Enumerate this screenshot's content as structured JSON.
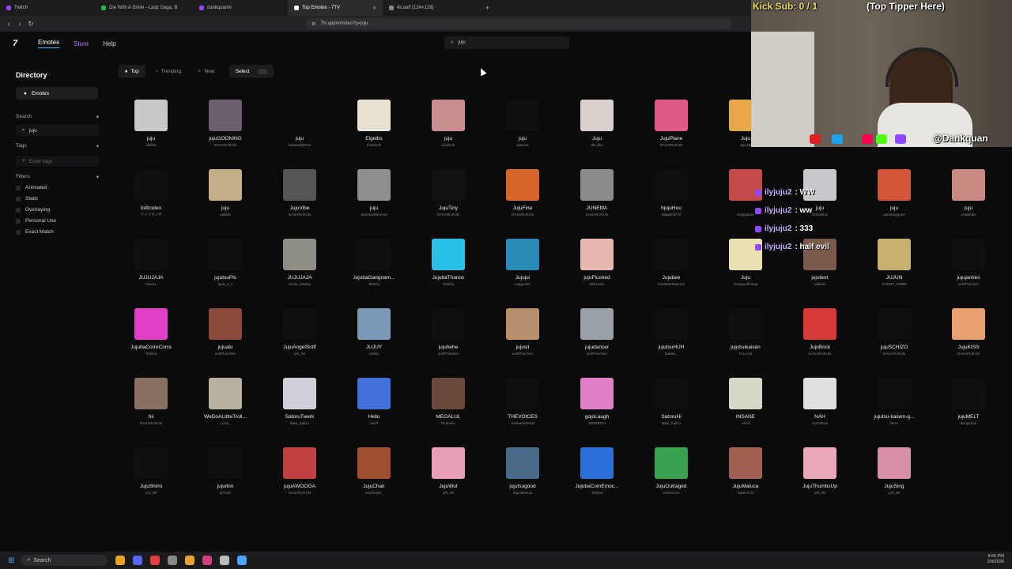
{
  "browser": {
    "tabs": [
      {
        "label": "Twitch",
        "active": false
      },
      {
        "label": "Die With A Smile - Lady Gaga, B",
        "active": false
      },
      {
        "label": "dankquantv",
        "active": false
      },
      {
        "label": "Top Emotes - 7TV",
        "active": true
      },
      {
        "label": "4x.avif (124×128)",
        "active": false
      }
    ],
    "url": "7tv.app/emotes?q=juju"
  },
  "nav": {
    "links": [
      "Emotes",
      "Store",
      "Help"
    ],
    "search_value": "juju"
  },
  "sidebar": {
    "title": "Directory",
    "emotes_label": "Emotes",
    "search_label": "Search",
    "search_value": "juju",
    "tags_label": "Tags",
    "tags_placeholder": "Enter tags",
    "filters_label": "Filters",
    "filters": [
      "Animated",
      "Static",
      "Overlaying",
      "Personal Use",
      "Exact Match"
    ]
  },
  "sort": {
    "options": [
      "Top",
      "Trending",
      "New"
    ],
    "select_label": "Select"
  },
  "emotes": [
    {
      "name": "juju",
      "owner": "obliibw",
      "color": "#c9c9c9"
    },
    {
      "name": "jujuGOONING",
      "owner": "DASARUKUN",
      "color": "#6b5f6e"
    },
    {
      "name": "juju",
      "owner": "DastardlyEmu",
      "color": "#0b0b0c"
    },
    {
      "name": "Eigelbs",
      "owner": "FrauSelfi",
      "color": "#e8e2d4"
    },
    {
      "name": "juju",
      "owner": "soullsok",
      "color": "#c98f8f"
    },
    {
      "name": "juju",
      "owner": "Steezur",
      "color": "#0f0f10"
    },
    {
      "name": "Juju",
      "owner": "die.jolis",
      "color": "#d9d0cc"
    },
    {
      "name": "JujuPlane",
      "owner": "DASARUKUN",
      "color": "#e05a86"
    },
    {
      "name": "Juju",
      "owner": "Jujizzle",
      "color": "#e8a84a"
    },
    {
      "name": "",
      "owner": "",
      "color": "#0b0b0c"
    },
    {
      "name": "",
      "owner": "",
      "color": "#0b0b0c"
    },
    {
      "name": "SPIN2WIN",
      "owner": "BananaJuju",
      "color": "#e8d36a"
    },
    {
      "name": "totticuleo",
      "owner": "ナイトカンサ",
      "color": "#0f0f10"
    },
    {
      "name": "juju",
      "owner": "obliibw",
      "color": "#c4ae8a"
    },
    {
      "name": "JujuVibe",
      "owner": "DASARUKUN",
      "color": "#555"
    },
    {
      "name": "juju",
      "owner": "SprinteyBeers44",
      "color": "#8e8e8e"
    },
    {
      "name": "JujuTiny",
      "owner": "DASARUKUN",
      "color": "#111"
    },
    {
      "name": "JujuFine",
      "owner": "DASARUKUN",
      "color": "#d7662a"
    },
    {
      "name": "JUNEMA",
      "owner": "DASARUKUN",
      "color": "#8a8a8a"
    },
    {
      "name": "hjujuHou",
      "owner": "SlagathorTV",
      "color": "#0f0f10"
    },
    {
      "name": "",
      "owner": "Seggsdoor",
      "color": "#c44a4a"
    },
    {
      "name": "juju",
      "owner": "chluonthis",
      "color": "#c8c8cc"
    },
    {
      "name": "juju",
      "owner": "aprilmayyjune",
      "color": "#d2553a"
    },
    {
      "name": "juju",
      "owner": "AnaBrisin",
      "color": "#c88a80"
    },
    {
      "name": "JUJUJAJA",
      "owner": "bitorex",
      "color": "#0f0f10"
    },
    {
      "name": "jujutsuPls",
      "owner": "igna_c_o",
      "color": "#0f0f10"
    },
    {
      "name": "JUJUJAJA",
      "owner": "Uncle_Missax",
      "color": "#8d8d84"
    },
    {
      "name": "JujubaGangnam...",
      "owner": "Telinha",
      "color": "#0f0f10"
    },
    {
      "name": "JujubaThanos",
      "owner": "Telinha",
      "color": "#2bc0e8"
    },
    {
      "name": "Jujujui",
      "owner": "LuigyAlen",
      "color": "#2a8bb8"
    },
    {
      "name": "jujuFlushed",
      "owner": "6Dhomie",
      "color": "#e8b8b0"
    },
    {
      "name": "Jujubee",
      "owner": "FeelsMattMan13",
      "color": "#0f0f10"
    },
    {
      "name": "Juju",
      "owner": "snoopyoffersop",
      "color": "#e8e0b0"
    },
    {
      "name": "jujubert",
      "owner": "valkarie",
      "color": "#7a5a4a"
    },
    {
      "name": "JUJUN",
      "owner": "GHOST_SIDEE",
      "color": "#c8b070"
    },
    {
      "name": "jujujamies",
      "owner": "achPhinchen",
      "color": "#0f0f10"
    },
    {
      "name": "JujubaCorreCorre",
      "owner": "Telinha",
      "color": "#e040c8"
    },
    {
      "name": "jujualu",
      "owner": "achPhinchen",
      "color": "#8a4a3a"
    },
    {
      "name": "JujuAngelSniff",
      "owner": "prh_99",
      "color": "#0f0f10"
    },
    {
      "name": "JUJUY",
      "owner": "renklu",
      "color": "#7a9ab8"
    },
    {
      "name": "jujuhehe",
      "owner": "achPhinchen",
      "color": "#0f0f10"
    },
    {
      "name": "jujusit",
      "owner": "achPhinchen",
      "color": "#b89070"
    },
    {
      "name": "jujudancer",
      "owner": "achPhinchen",
      "color": "#9aa0a8"
    },
    {
      "name": "jujutsuHUH",
      "owner": "Darlax_",
      "color": "#0f0f10"
    },
    {
      "name": "jujutsukaisen",
      "owner": "FULA16",
      "color": "#0f0f10"
    },
    {
      "name": "JujuBrick",
      "owner": "DASARUKUN",
      "color": "#d83a3a"
    },
    {
      "name": "jujuSCHIZO",
      "owner": "DASARUKUN",
      "color": "#0f0f10"
    },
    {
      "name": "JujuKISS",
      "owner": "DASARUKUN",
      "color": "#e8a070"
    },
    {
      "name": "hii",
      "owner": "DASARUKUN",
      "color": "#8a7060"
    },
    {
      "name": "WeDoALittleTroll...",
      "owner": "Lizon_",
      "color": "#b8b0a0"
    },
    {
      "name": "SatoruTwerk",
      "owner": "Maxi_Kalico",
      "color": "#d0d0d8"
    },
    {
      "name": "Hello",
      "owner": "Aezif",
      "color": "#4070d8"
    },
    {
      "name": "MEGALUL",
      "owner": "Rirubinto",
      "color": "#6a4a3a"
    },
    {
      "name": "THEVOICES",
      "owner": "marianaram18",
      "color": "#0f0f10"
    },
    {
      "name": "gojoLaugh",
      "owner": "MIRRROH",
      "color": "#e080c8"
    },
    {
      "name": "SatoruHi",
      "owner": "Maxi_Kalico",
      "color": "#0f0f10"
    },
    {
      "name": "INSANE",
      "owner": "Aezif",
      "color": "#d8d8c8"
    },
    {
      "name": "NAH",
      "owner": "GvmShoe",
      "color": "#e0e0e0"
    },
    {
      "name": "jujutsu-kaisen-g...",
      "owner": "l04zo",
      "color": "#0f0f10"
    },
    {
      "name": "jujuMELT",
      "owner": "Bongchue",
      "color": "#0f0f10"
    },
    {
      "name": "JujuShimi",
      "owner": "prh_99",
      "color": "#0f0f10"
    },
    {
      "name": "jujurkin",
      "owner": "qvToxic",
      "color": "#0f0f10"
    },
    {
      "name": "jujuAWOOGA",
      "owner": "DASARUKUN",
      "color": "#c04040"
    },
    {
      "name": "JujuChair",
      "owner": "Voorhoofd_",
      "color": "#a05030"
    },
    {
      "name": "JujuWut",
      "owner": "prh_99",
      "color": "#e8a0b8"
    },
    {
      "name": "jujutsugood",
      "owner": "Supcakezou",
      "color": "#4a6a8a"
    },
    {
      "name": "JujubaComEmoc...",
      "owner": "Telinha",
      "color": "#2a70d8"
    },
    {
      "name": "JujuOutraged",
      "owner": "Gamerrzin",
      "color": "#3aa050"
    },
    {
      "name": "JujuMaluca",
      "owner": "Gamerrzin",
      "color": "#a06050"
    },
    {
      "name": "JujuThumbsUp",
      "owner": "prh_99",
      "color": "#e8a8b8"
    },
    {
      "name": "JujuSing",
      "owner": "prh_99",
      "color": "#d890a8"
    }
  ],
  "stream_overlay": {
    "kick_sub": "Kick Sub: 0 / 1",
    "top_tipper": "(Top Tipper Here)",
    "handle": "@Dankquan",
    "chat": [
      {
        "user": "ilyjuju2",
        "message": ": WW"
      },
      {
        "user": "ilyjuju2",
        "message": ": ww"
      },
      {
        "user": "ilyjuju2",
        "message": ": 333"
      },
      {
        "user": "ilyjuju2",
        "message": ": half evil"
      }
    ]
  },
  "taskbar": {
    "search_label": "Search",
    "time": "8:55 PM",
    "date": "2/9/2026"
  },
  "colors": {
    "accent": "#29b6f6",
    "store": "#b47cff",
    "twitch": "#9146ff"
  }
}
